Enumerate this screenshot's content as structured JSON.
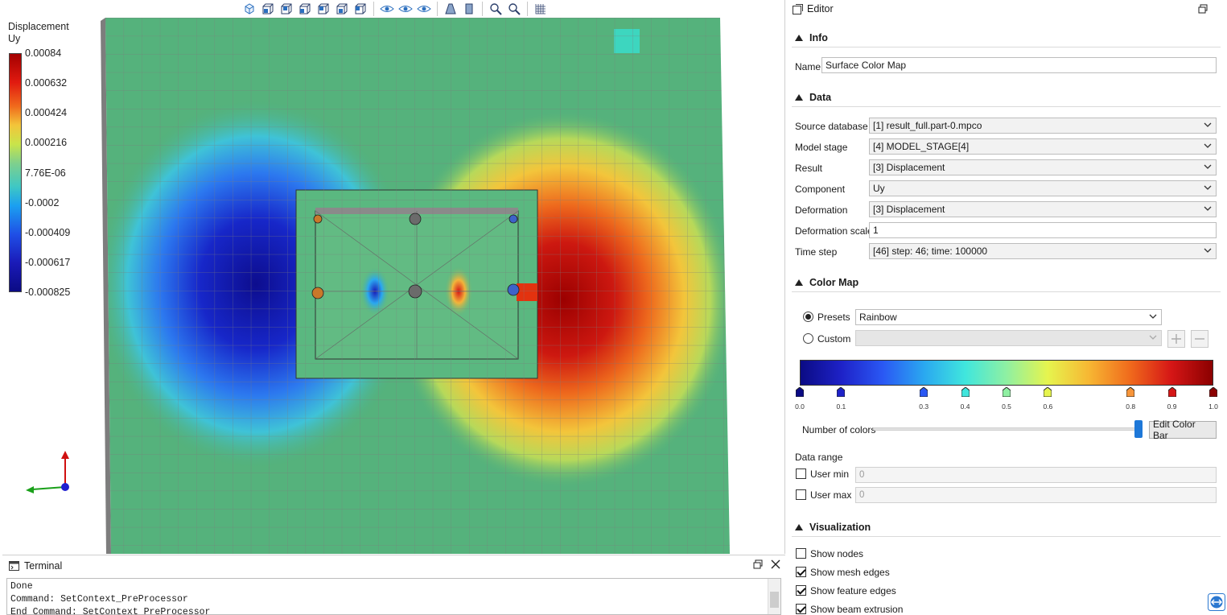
{
  "legend": {
    "title_line1": "Displacement",
    "title_line2": "Uy",
    "ticks": [
      "0.00084",
      "0.000632",
      "0.000424",
      "0.000216",
      "7.76E-06",
      "-0.0002",
      "-0.000409",
      "-0.000617",
      "-0.000825"
    ]
  },
  "toolbar": {
    "icons": [
      "view-iso-icon",
      "view-front-icon",
      "view-back-icon",
      "view-left-icon",
      "view-right-icon",
      "view-top-icon",
      "view-bottom-icon",
      "hide-icon",
      "show-icon",
      "show-all-icon",
      "perspective-icon",
      "parallel-icon",
      "zoom-fit-icon",
      "zoom-region-icon",
      "grid-icon"
    ]
  },
  "terminal": {
    "title": "Terminal",
    "lines": [
      "Done",
      "Command: SetContext_PreProcessor",
      "End Command: SetContext_PreProcessor"
    ]
  },
  "editor": {
    "title": "Editor",
    "sections": {
      "info": "Info",
      "data": "Data",
      "color_map": "Color Map",
      "visualization": "Visualization"
    },
    "name_label": "Name",
    "name_value": "Surface Color Map",
    "fields": [
      {
        "label": "Source database",
        "value": "[1] result_full.part-0.mpco",
        "type": "combo"
      },
      {
        "label": "Model stage",
        "value": "[4] MODEL_STAGE[4]",
        "type": "combo"
      },
      {
        "label": "Result",
        "value": "[3] Displacement",
        "type": "combo"
      },
      {
        "label": "Component",
        "value": "Uy",
        "type": "combo"
      },
      {
        "label": "Deformation",
        "value": "[3] Displacement",
        "type": "combo"
      },
      {
        "label": "Deformation scale",
        "value": "1",
        "type": "text"
      },
      {
        "label": "Time step",
        "value": "[46] step: 46; time: 100000",
        "type": "combo"
      }
    ],
    "color_map": {
      "presets_label": "Presets",
      "presets_value": "Rainbow",
      "custom_label": "Custom",
      "stops": [
        "0.0",
        "0.1",
        "0.3",
        "0.4",
        "0.5",
        "0.6",
        "0.8",
        "0.9",
        "1.0"
      ],
      "stop_colors": [
        "#0b0b84",
        "#1e22c8",
        "#2a58f4",
        "#40e6dd",
        "#8ff0a2",
        "#e6f44e",
        "#f7953a",
        "#d51616",
        "#8b0000"
      ],
      "number_of_colors_label": "Number of colors",
      "number_of_colors_level": 1.0,
      "edit_button": "Edit Color Bar",
      "data_range_label": "Data range",
      "user_min_label": "User min",
      "user_min_value": "0",
      "user_max_label": "User max",
      "user_max_value": "0"
    },
    "visualization": [
      {
        "label": "Show nodes",
        "checked": false
      },
      {
        "label": "Show mesh edges",
        "checked": true
      },
      {
        "label": "Show feature edges",
        "checked": true
      },
      {
        "label": "Show beam extrusion",
        "checked": true
      }
    ]
  }
}
